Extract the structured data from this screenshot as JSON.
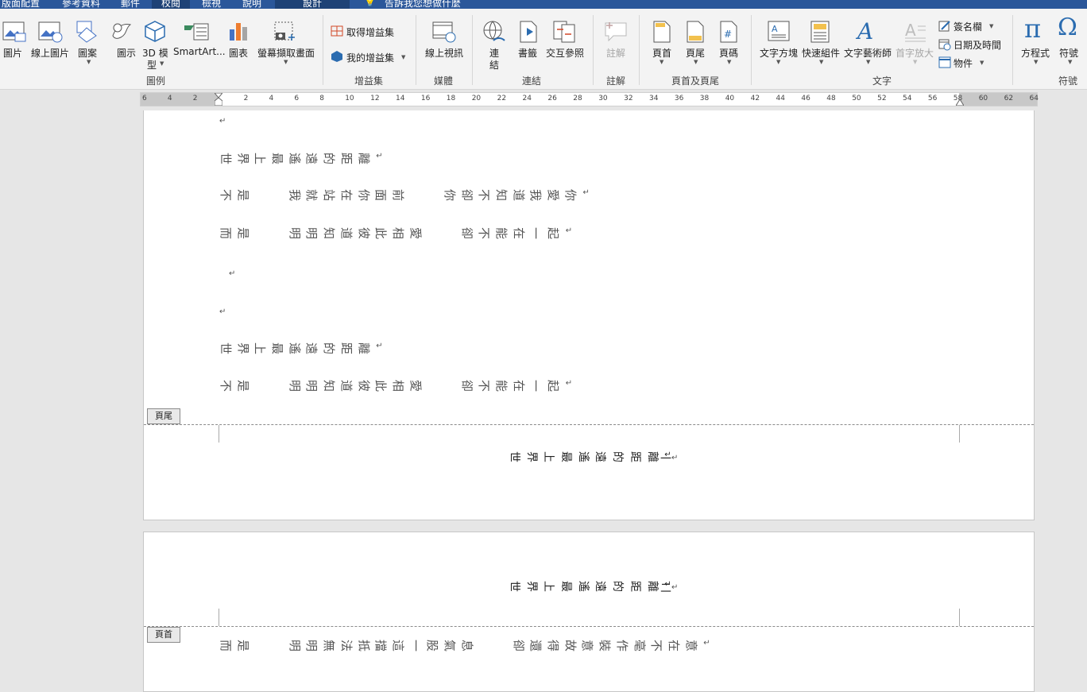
{
  "tabs": [
    "版面配置",
    "參考資料",
    "郵件",
    "校閱",
    "檢視",
    "說明",
    "設計",
    "告訴我您想做什麼"
  ],
  "ribbon": {
    "illustrations": {
      "pictures": "圖片",
      "online_pictures": "線上圖片",
      "shapes": "圖案",
      "icons": "圖示",
      "model3d_1": "3D 模",
      "model3d_2": "型",
      "smartart": "SmartArt...",
      "chart": "圖表",
      "screenshot": "螢幕擷取畫面",
      "group": "圖例"
    },
    "addins": {
      "get": "取得增益集",
      "my": "我的增益集",
      "group": "增益集"
    },
    "media": {
      "online_video": "線上視訊",
      "group": "媒體"
    },
    "links": {
      "link_1": "連",
      "link_2": "結",
      "bookmark": "書籤",
      "crossref": "交互參照",
      "group": "連結"
    },
    "comments": {
      "comment": "註解",
      "group": "註解"
    },
    "header_footer": {
      "header": "頁首",
      "footer": "頁尾",
      "page_number": "頁碼",
      "group": "頁首及頁尾"
    },
    "text": {
      "textbox": "文字方塊",
      "quickparts": "快速組件",
      "wordart": "文字藝術師",
      "dropcap": "首字放大",
      "signature": "簽名欄",
      "datetime": "日期及時間",
      "object": "物件",
      "group": "文字"
    },
    "symbols": {
      "equation": "方程式",
      "symbol": "符號",
      "group": "符號"
    }
  },
  "ruler": [
    "6",
    "4",
    "2",
    "",
    "2",
    "4",
    "6",
    "8",
    "10",
    "12",
    "14",
    "16",
    "18",
    "20",
    "22",
    "24",
    "26",
    "28",
    "30",
    "32",
    "34",
    "36",
    "38",
    "40",
    "42",
    "44",
    "46",
    "48",
    "50",
    "52",
    "54",
    "56",
    "58",
    "60",
    "62",
    "64"
  ],
  "page1": {
    "lines": [
      {
        "id": "l1",
        "text": "世界上最遙遠的距離"
      },
      {
        "id": "l2",
        "text": "不是　　我就站在你面前　　你卻不知道我愛你"
      },
      {
        "id": "l3",
        "text": "而是　　明明知道彼此相愛　　卻不能在一起"
      },
      {
        "id": "l4",
        "text": "世界上最遙遠的距離"
      },
      {
        "id": "l5",
        "text": "不是　　明明知道彼此相愛　　卻不能在一起"
      }
    ],
    "footer_label": "頁尾",
    "footer_text": "世界上最遙遠的距離",
    "footer_page": "一"
  },
  "page2": {
    "header_text": "世界上最遙遠的距離",
    "header_page": "二",
    "header_label": "頁首",
    "body_line": "而是　　明明無法抵擋這一股氣息　　卻還得故意裝作毫不在意"
  },
  "return_mark": "↵",
  "colors": {
    "tabbar": "#2b579a",
    "accent": "#2b579a"
  }
}
